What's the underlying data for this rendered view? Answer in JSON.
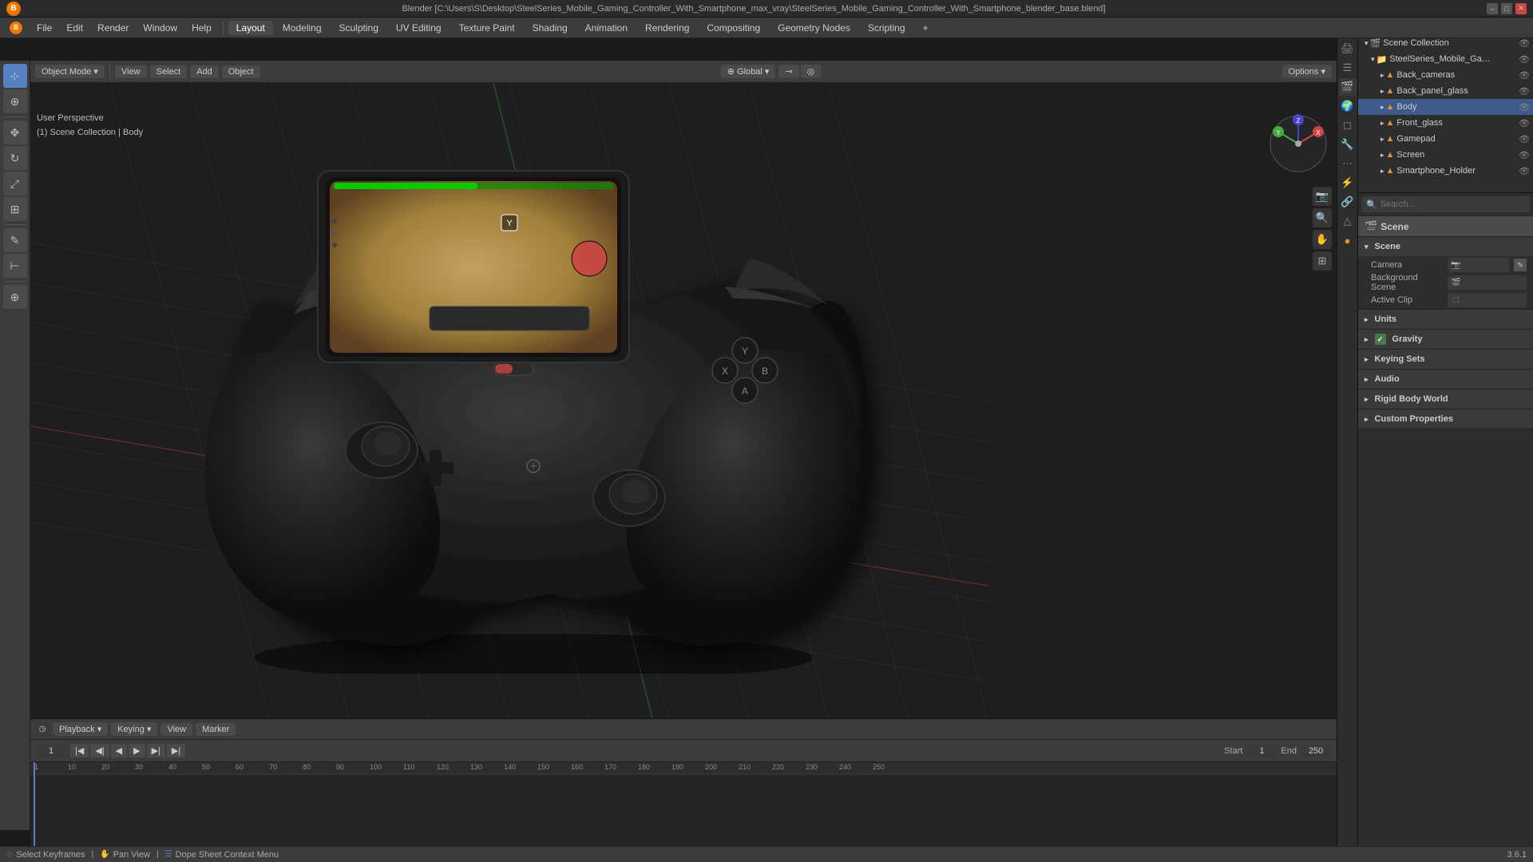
{
  "window": {
    "title": "Blender [C:\\Users\\S\\Desktop\\SteelSeries_Mobile_Gaming_Controller_With_Smartphone_max_vray\\SteelSeries_Mobile_Gaming_Controller_With_Smartphone_blender_base.blend]"
  },
  "menubar": {
    "items": [
      "Blender",
      "File",
      "Edit",
      "Render",
      "Window",
      "Help"
    ]
  },
  "workspaces": {
    "tabs": [
      "Layout",
      "Modeling",
      "Sculpting",
      "UV Editing",
      "Texture Paint",
      "Shading",
      "Animation",
      "Rendering",
      "Compositing",
      "Geometry Nodes",
      "Scripting"
    ],
    "active": "Layout",
    "add_btn": "+"
  },
  "viewport": {
    "header": {
      "object_mode_label": "Object Mode",
      "global_label": "Global",
      "options_label": "Options"
    },
    "info": {
      "line1": "User Perspective",
      "line2": "(1) Scene Collection | Body"
    },
    "gizmo": {
      "x_label": "X",
      "y_label": "Y",
      "z_label": "Z"
    }
  },
  "toolbar": {
    "tools": [
      {
        "name": "select",
        "icon": "⊹"
      },
      {
        "name": "cursor",
        "icon": "⊕"
      },
      {
        "name": "move",
        "icon": "✥"
      },
      {
        "name": "rotate",
        "icon": "↻"
      },
      {
        "name": "scale",
        "icon": "⤢"
      },
      {
        "name": "transform",
        "icon": "⊞"
      },
      {
        "name": "annotate",
        "icon": "✎"
      },
      {
        "name": "measure",
        "icon": "⊢"
      },
      {
        "name": "add",
        "icon": "⊕"
      }
    ]
  },
  "outliner": {
    "title": "Scene Collection",
    "items": [
      {
        "name": "SteelSeries_Mobile_Gaming_Controller_",
        "depth": 1,
        "type": "collection",
        "icon": "▸"
      },
      {
        "name": "Back_cameras",
        "depth": 2,
        "type": "object",
        "icon": "▸"
      },
      {
        "name": "Back_panel_glass",
        "depth": 2,
        "type": "object",
        "icon": "▸"
      },
      {
        "name": "Body",
        "depth": 2,
        "type": "object",
        "icon": "▸",
        "selected": true
      },
      {
        "name": "Front_glass",
        "depth": 2,
        "type": "object",
        "icon": "▸"
      },
      {
        "name": "Gamepad",
        "depth": 2,
        "type": "object",
        "icon": "▸"
      },
      {
        "name": "Screen",
        "depth": 2,
        "type": "object",
        "icon": "▸"
      },
      {
        "name": "Smartphone_Holder",
        "depth": 2,
        "type": "object",
        "icon": "▸"
      }
    ]
  },
  "properties": {
    "tabs": [
      "render",
      "output",
      "view_layer",
      "scene",
      "world",
      "object",
      "modifier",
      "particles",
      "physics",
      "constraints",
      "object_data",
      "material",
      "uv"
    ],
    "active_tab": "scene",
    "scene_label": "Scene",
    "sections": {
      "scene": {
        "header": "Scene",
        "camera_label": "Camera",
        "background_scene_label": "Background Scene",
        "active_clip_label": "Active Clip"
      },
      "units": {
        "header": "Units"
      },
      "gravity": {
        "header": "Gravity",
        "enabled": true
      },
      "keying_sets": {
        "header": "Keying Sets"
      },
      "audio": {
        "header": "Audio"
      },
      "rigid_body_world": {
        "header": "Rigid Body World"
      },
      "custom_properties": {
        "header": "Custom Properties"
      }
    }
  },
  "timeline": {
    "header_items": [
      "Playback",
      "Keying",
      "View",
      "Marker"
    ],
    "playback_label": "Playback",
    "keying_label": "Keying",
    "view_label": "View",
    "marker_label": "Marker",
    "frame_current": "1",
    "frame_start_label": "Start",
    "frame_start": "1",
    "frame_end_label": "End",
    "frame_end": "250",
    "ticks": [
      "1",
      "10",
      "20",
      "30",
      "40",
      "50",
      "60",
      "70",
      "80",
      "90",
      "100",
      "110",
      "120",
      "130",
      "140",
      "150",
      "160",
      "170",
      "180",
      "190",
      "200",
      "210",
      "220",
      "230",
      "240",
      "250"
    ],
    "playback_controls": [
      "⏮",
      "⏪",
      "◀",
      "▶",
      "▶▶",
      "⏭"
    ]
  },
  "status_bar": {
    "left_items": [
      "Select Keyframes",
      "Pan View",
      "Dope Sheet Context Menu"
    ],
    "right_version": "3.6.1"
  },
  "colors": {
    "accent_blue": "#5680c2",
    "active_orange": "#e88e2d",
    "bg_dark": "#1a1a1a",
    "bg_panel": "#2d2d2d",
    "bg_header": "#3c3c3c",
    "axis_x": "#c44",
    "axis_y": "#4a4",
    "axis_z": "#44c"
  }
}
